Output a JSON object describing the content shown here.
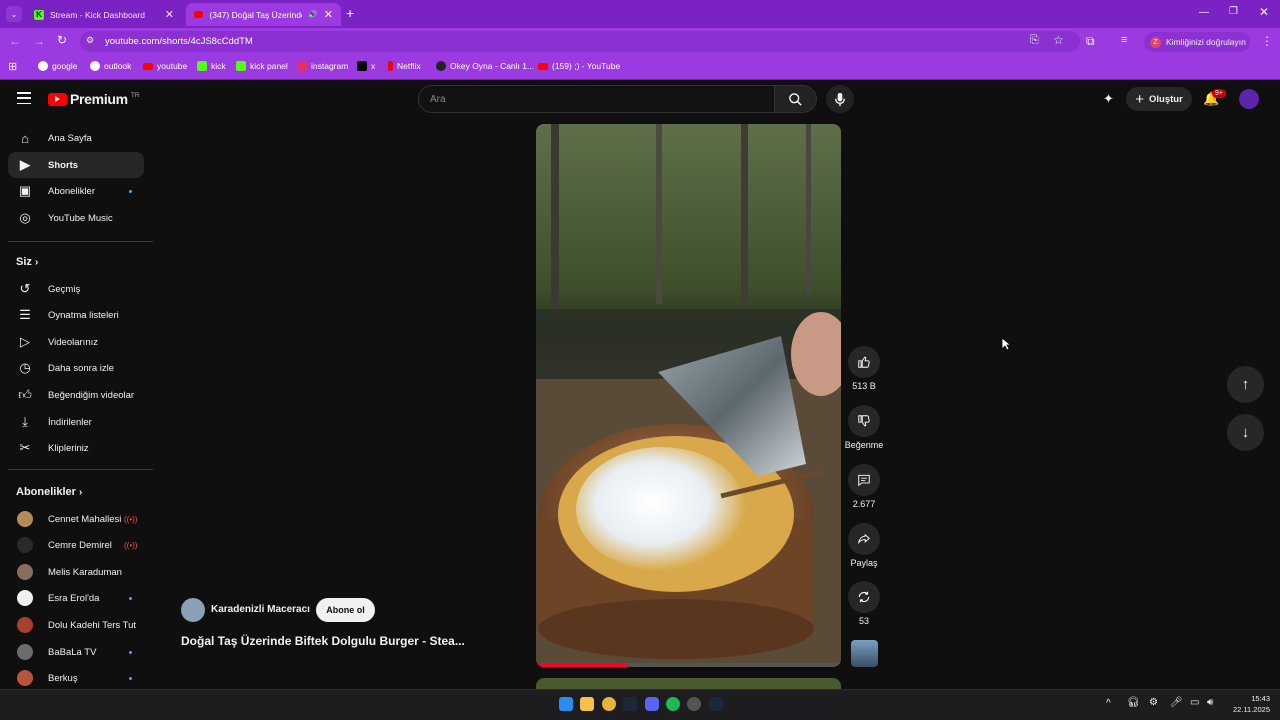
{
  "browser": {
    "tabs": [
      {
        "title": "Stream - Kick Dashboard"
      },
      {
        "title": "(347) Doğal Taş Üzerinde B"
      }
    ],
    "new_tab": "+",
    "url": "youtube.com/shorts/4cJS8cCddTM",
    "profile_label": "Kimliğinizi doğrulayın",
    "profile_initial": "Z",
    "bookmarks": [
      "google",
      "outlook",
      "youtube",
      "kick",
      "kick panel",
      "instagram",
      "x",
      "Netflix",
      "Okey Oyna - Canlı 1...",
      "(159) ;) - YouTube"
    ]
  },
  "youtube": {
    "logo_text": "Premium",
    "region": "TR",
    "search_placeholder": "Ara",
    "create_label": "Oluştur",
    "notification_badge": "9+",
    "sidebar": {
      "main": [
        "Ana Sayfa",
        "Shorts",
        "Abonelikler",
        "YouTube Music"
      ],
      "you_title": "Siz",
      "you_items": [
        "Geçmiş",
        "Oynatma listeleri",
        "Videolarınız",
        "Daha sonra izle",
        "Beğendiğim videolar",
        "İndirilenler",
        "Klipleriniz"
      ],
      "subs_title": "Abonelikler",
      "subs": [
        {
          "name": "Cennet Mahallesi",
          "status": "live"
        },
        {
          "name": "Cemre Demirel",
          "status": "live"
        },
        {
          "name": "Melis Karaduman",
          "status": ""
        },
        {
          "name": "Esra Erol'da",
          "status": "new"
        },
        {
          "name": "Dolu Kadehi Ters Tut",
          "status": ""
        },
        {
          "name": "BaBaLa TV",
          "status": "new"
        },
        {
          "name": "Berkuş",
          "status": "new"
        }
      ]
    },
    "short": {
      "channel": "Karadenizli Maceracı",
      "subscribe": "Abone ol",
      "title": "Doğal Taş Üzerinde Biftek Dolgulu Burger - Stea...",
      "progress": 0.3,
      "likes": "513 B",
      "dislike_label": "Beğenme",
      "comments": "2.677",
      "share_label": "Paylaş",
      "remix_count": "53"
    }
  },
  "taskbar": {
    "time": "15:43",
    "date": "22.11.2025"
  }
}
